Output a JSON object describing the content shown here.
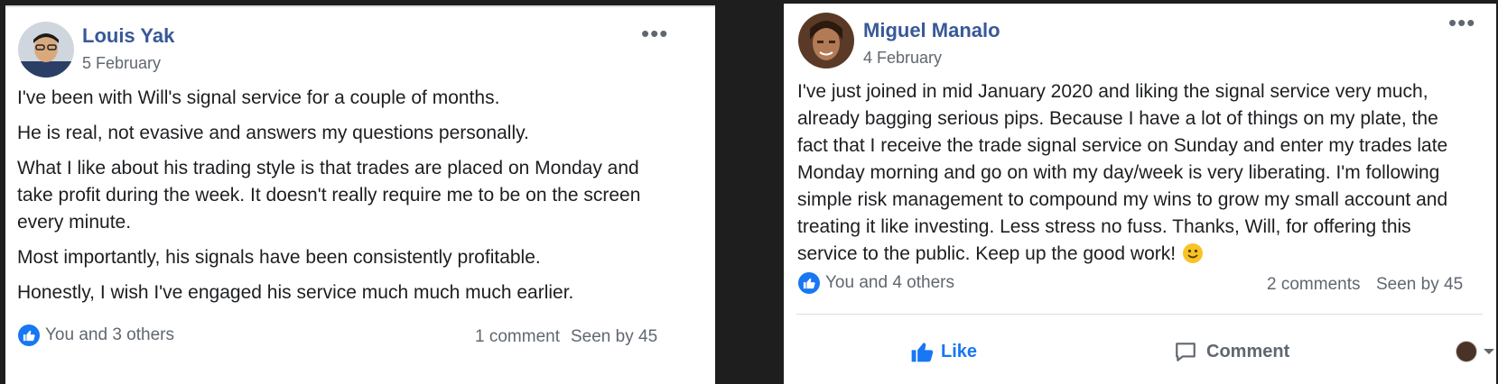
{
  "posts": [
    {
      "author": "Louis Yak",
      "date": "5 February",
      "more": "•••",
      "paragraphs": [
        "I've been with Will's signal service for a couple of months.",
        "He is real, not evasive and answers my questions personally.",
        "What I like about his trading style is that trades are placed on Monday and take profit during the week. It doesn't really require me to be on the screen every minute.",
        "Most importantly, his signals have been consistently profitable.",
        "Honestly, I wish I've engaged his service much much much earlier."
      ],
      "reactions": "You and 3 others",
      "comments": "1 comment",
      "seen": "Seen by 45"
    },
    {
      "author": "Miguel Manalo",
      "date": "4 February",
      "more": "•••",
      "body": "I've just joined in mid January 2020 and liking the signal service very much, already bagging serious pips. Because I have a lot of things on my plate, the fact that I receive the trade signal service on Sunday and enter my trades late Monday morning and go on with my day/week is very liberating. I'm following simple risk management to compound my wins to grow my small account and treating it like investing. Less stress no fuss. Thanks, Will, for offering this service to the public. Keep up the good work!",
      "reactions": "You and 4 others",
      "comments": "2 comments",
      "seen": "Seen by 45",
      "like_label": "Like",
      "comment_label": "Comment"
    }
  ],
  "colors": {
    "brand": "#1877f2",
    "name": "#385898",
    "meta": "#606770"
  }
}
